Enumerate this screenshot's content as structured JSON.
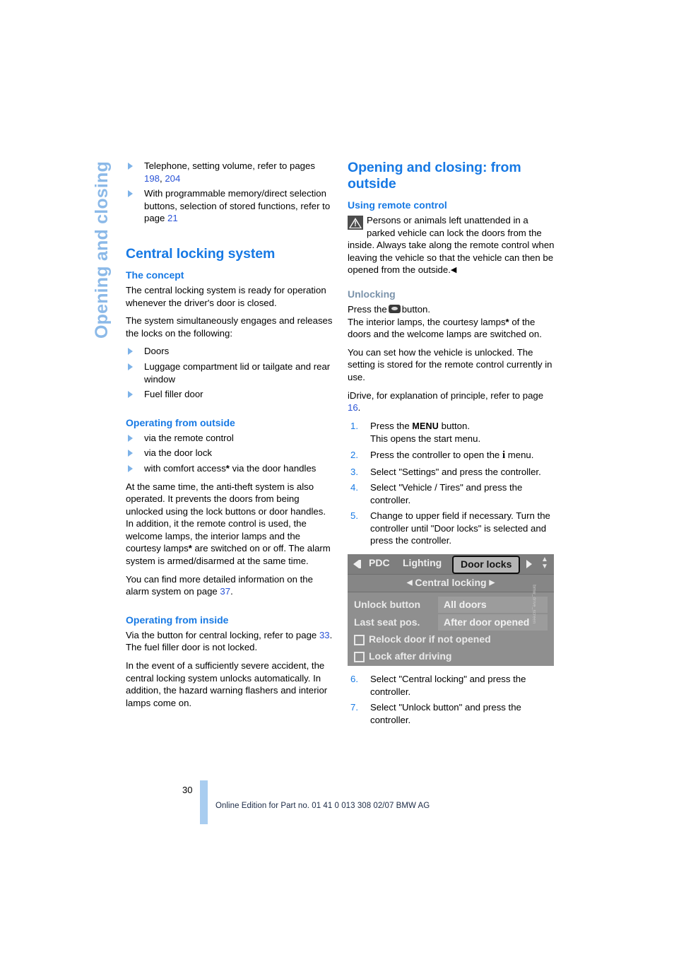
{
  "chapter_tab": {
    "label": "Opening and closing"
  },
  "left_column": {
    "top_bullets": [
      "Telephone, setting volume, refer to pages 198, 204",
      "With programmable memory/direct selection buttons, selection of stored functions, refer to page 21"
    ],
    "top_bullet_1_text": "Telephone, setting volume, refer to pages ",
    "top_bullet_1_ref_a": "198",
    "top_bullet_1_sep": ", ",
    "top_bullet_1_ref_b": "204",
    "top_bullet_2_text": "With programmable memory/direct selection buttons, selection of stored functions, refer to page ",
    "top_bullet_2_ref": "21",
    "section_title": "Central locking system",
    "concept": {
      "heading": "The concept",
      "p1": "The central locking system is ready for operation whenever the driver's door is closed.",
      "p2": "The system simultaneously engages and releases the locks on the following:",
      "items": [
        "Doors",
        "Luggage compartment lid or tailgate and rear window",
        "Fuel filler door"
      ]
    },
    "outside": {
      "heading": "Operating from outside",
      "items_plain": [
        "via the remote control",
        "via the door lock"
      ],
      "item_comfort_pre": "with comfort access",
      "item_comfort_star": "*",
      "item_comfort_post": " via the door handles",
      "p1_a": "At the same time, the anti-theft system is also operated. It prevents the doors from being unlocked using the lock buttons or door handles. In addition, it the remote control is used, the welcome lamps, the interior lamps and the courtesy lamps",
      "p1_star": "*",
      "p1_b": " are switched on or off. The alarm system is armed/disarmed at the same time.",
      "p2_a": "You can find more detailed information on the alarm system on page ",
      "p2_ref": "37",
      "p2_b": "."
    },
    "inside": {
      "heading": "Operating from inside",
      "p1_a": "Via the button for central locking, refer to page ",
      "p1_ref": "33",
      "p1_b": ". The fuel filler door is not locked.",
      "p2": "In the event of a sufficiently severe accident, the central locking system unlocks automatically. In addition, the hazard warning flashers and interior lamps come on."
    }
  },
  "right_column": {
    "section_title": "Opening and closing: from outside",
    "remote": {
      "heading": "Using remote control",
      "warning_text": "Persons or animals left unattended in a parked vehicle can lock the doors from the inside. Always take along the remote control when leaving the vehicle so that the vehicle can then be opened from the outside.",
      "warning_end_marker": "◀"
    },
    "unlocking": {
      "heading": "Unlocking",
      "press_pre": "Press the",
      "press_post": "button.",
      "p1_a": "The interior lamps, the courtesy lamps",
      "p1_star": "*",
      "p1_b": " of the doors and the welcome lamps are switched on.",
      "p2": "You can set how the vehicle is unlocked. The setting is stored for the remote control currently in use.",
      "p3_a": "iDrive, for explanation of principle, refer to page ",
      "p3_ref": "16",
      "p3_b": ".",
      "steps": [
        {
          "pre": "Press the ",
          "bold": "MENU",
          "post": " button.",
          "line2": "This opens the start menu."
        },
        {
          "pre": "Press the controller to open the ",
          "bold": "i",
          "post": " menu.",
          "line2": ""
        },
        {
          "pre": "Select \"Settings\" and press the controller.",
          "bold": "",
          "post": "",
          "line2": ""
        },
        {
          "pre": "Select \"Vehicle / Tires\" and press the controller.",
          "bold": "",
          "post": "",
          "line2": ""
        },
        {
          "pre": "Change to upper field if necessary. Turn the controller until \"Door locks\" is selected and press the controller.",
          "bold": "",
          "post": "",
          "line2": ""
        }
      ],
      "steps_after": [
        "Select \"Central locking\" and press the controller.",
        "Select \"Unlock button\" and press the controller."
      ]
    },
    "idrive_screen": {
      "tabs": [
        "PDC",
        "Lighting"
      ],
      "selected_tab": "Door locks",
      "subtitle": "Central locking",
      "rows": [
        {
          "label": "Unlock button",
          "value": "All doors"
        },
        {
          "label": "Last seat pos.",
          "value": "After door opened"
        }
      ],
      "checkboxes": [
        "Relock door if not opened",
        "Lock after driving"
      ],
      "credit": "bmw_drive_screen"
    }
  },
  "footer": {
    "page_number": "30",
    "text": "Online Edition for Part no. 01 41 0 013 308 02/07 BMW AG"
  },
  "colors": {
    "heading_blue": "#1779e4",
    "link_blue": "#2a53d6",
    "tab_blue": "#8bb9e8",
    "subheading_grey": "#7b93ab",
    "footer_bar": "#a9cdf0"
  }
}
